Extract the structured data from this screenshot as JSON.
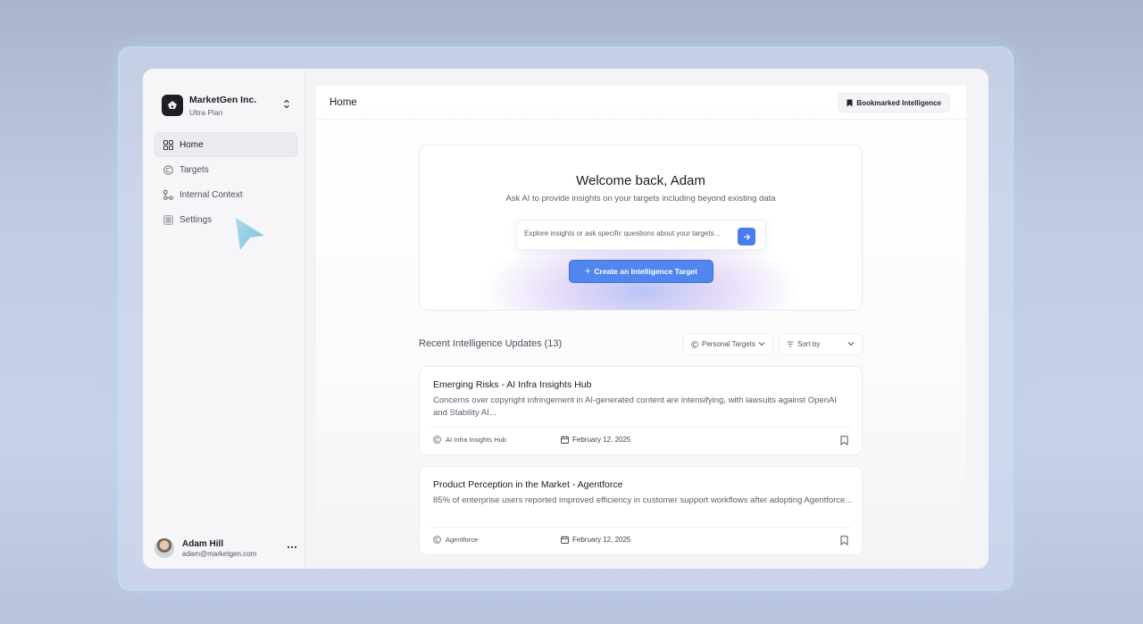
{
  "org": {
    "name": "MarketGen Inc.",
    "plan": "Ultra Plan"
  },
  "nav": {
    "items": [
      {
        "label": "Home",
        "icon": "grid-icon",
        "active": true
      },
      {
        "label": "Targets",
        "icon": "target-c-icon",
        "active": false
      },
      {
        "label": "Internal Context",
        "icon": "nodes-icon",
        "active": false
      },
      {
        "label": "Settings",
        "icon": "settings-icon",
        "active": false
      }
    ]
  },
  "user": {
    "name": "Adam Hill",
    "email": "adam@marketgen.com"
  },
  "header": {
    "title": "Home",
    "bookmark_label": "Bookmarked Intelligence"
  },
  "welcome": {
    "title": "Welcome back, Adam",
    "subtitle": "Ask AI to provide insights on your targets including beyond existing data",
    "placeholder": "Explore insights or ask specific questions about your targets...",
    "create_label": "Create an Intelligence Target"
  },
  "updates": {
    "title": "Recent Intelligence Updates (13)",
    "filter_label": "Personal Targets",
    "sort_label": "Sort by",
    "items": [
      {
        "title": "Emerging Risks - AI Infra Insights Hub",
        "description": "Concerns over copyright infringement in AI-generated content are intensifying, with lawsuits against OpenAI and Stability AI...",
        "source": "AI Infra Insights Hub",
        "date": "February 12, 2025"
      },
      {
        "title": "Product Perception in the Market - Agentforce",
        "description": "85% of enterprise users reported improved efficiency in customer support workflows after adopting Agentforce...",
        "source": "Agentforce",
        "date": "February 12, 2025"
      }
    ]
  },
  "colors": {
    "accent": "#5286ef",
    "send_button": "#4a7cf0"
  }
}
